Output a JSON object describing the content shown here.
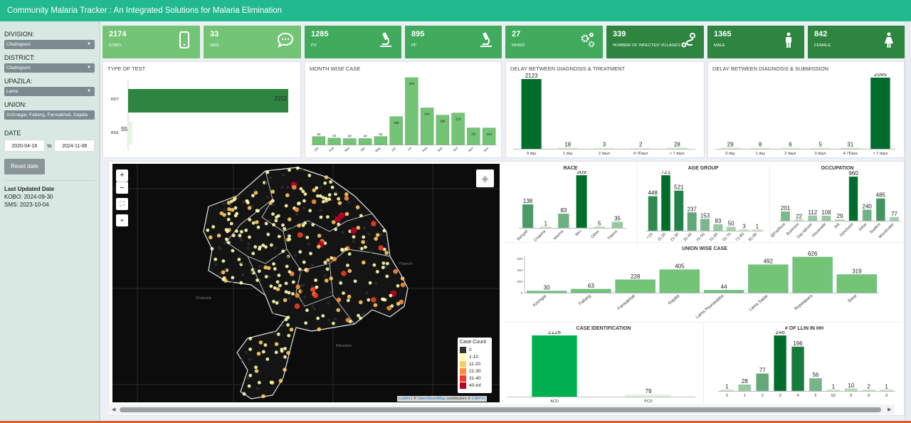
{
  "app_title": "Community Malaria Tracker : An Integrated Solutions for Malaria Elimination",
  "sidebar": {
    "division_label": "DIVISION:",
    "division_value": "Chattogram",
    "district_label": "DISTRICT:",
    "district_value": "Chattogram",
    "upazila_label": "UPAZILA:",
    "upazila_value": "Lama",
    "union_label": "UNION:",
    "union_value": "Aziznagar, Faitang, Fansiakhali, Gajalia",
    "date_label": "DATE",
    "date_from": "2020-04-18",
    "date_to_label": "to",
    "date_to": "2024-11-06",
    "reset_label": "Reset date",
    "last_updated_title": "Last Updated Date",
    "kobo_updated": "KOBO: 2024-09-30",
    "sms_updated": "SMS: 2023-10-04"
  },
  "kpis": [
    {
      "value": "2174",
      "label": "KOBO",
      "color": "#74c476",
      "icon": "mobile-phone-icon"
    },
    {
      "value": "33",
      "label": "SMS",
      "color": "#74c476",
      "icon": "chat-bubble-icon"
    },
    {
      "value": "1285",
      "label": "PV",
      "color": "#41ab5d",
      "icon": "microscope-icon"
    },
    {
      "value": "895",
      "label": "PF",
      "color": "#41ab5d",
      "icon": "microscope-icon"
    },
    {
      "value": "27",
      "label": "MIXED",
      "color": "#41ab5d",
      "icon": "gears-icon"
    },
    {
      "value": "339",
      "label": "NUMBER OF INFECTED VILLAGES",
      "color": "#2e8540",
      "icon": "route-icon"
    },
    {
      "value": "1365",
      "label": "MALE",
      "color": "#2e8540",
      "icon": "male-icon"
    },
    {
      "value": "842",
      "label": "FEMALE",
      "color": "#2e8540",
      "icon": "female-icon"
    }
  ],
  "panels": {
    "type_of_test": "TYPE OF TEST",
    "month_wise": "MONTH WISE CASE",
    "delay_treatment": "DELAY BETWEEN DIAGNOSIS & TREATMENT",
    "delay_submission": "DELAY BETWEEN DIAGNOSIS & SUBMISSION",
    "race": "RACE",
    "age_group": "AGE GROUP",
    "occupation": "OCCUPATION",
    "union_wise": "UNION WISE CASE",
    "case_identification": "CASE IDENTIFICATION",
    "llin": "# OF LLIN IN HH"
  },
  "map": {
    "zoom_in": "+",
    "zoom_out": "−",
    "place_1": "Thanchi",
    "place_2": "Chakaria",
    "place_3": "Alikadam",
    "legend_title": "Case Count",
    "legend": [
      {
        "label": "0",
        "color": "#333333"
      },
      {
        "label": "1-10",
        "color": "#ffffb2"
      },
      {
        "label": "11-20",
        "color": "#fecc5c"
      },
      {
        "label": "21-30",
        "color": "#fd8d3c"
      },
      {
        "label": "31-40",
        "color": "#f03b20"
      },
      {
        "label": "40-Inf",
        "color": "#bd0026"
      }
    ],
    "attribution_leaflet": "Leaflet",
    "attribution_sep": " | © ",
    "attribution_osm": "OpenStreetMap",
    "attribution_mid": " contributors © ",
    "attribution_carto": "CARTO"
  },
  "chart_data": [
    {
      "id": "type_of_test",
      "type": "bar",
      "orientation": "horizontal",
      "categories": [
        "RDT",
        "BSE"
      ],
      "values": [
        2152,
        55
      ]
    },
    {
      "id": "month_wise",
      "type": "bar",
      "categories": [
        "Jan",
        "Feb",
        "Mar",
        "Apr",
        "May",
        "Jun",
        "Jul",
        "Aug",
        "Sep",
        "Oct",
        "Nov",
        "Dec"
      ],
      "values": [
        53,
        43,
        40,
        40,
        53,
        186,
        446,
        244,
        196,
        210,
        111,
        110
      ]
    },
    {
      "id": "delay_treatment",
      "type": "bar",
      "categories": [
        "0 day",
        "1 day",
        "2 days",
        "4-7Days",
        "> 7 days"
      ],
      "values": [
        2123,
        18,
        3,
        2,
        28
      ]
    },
    {
      "id": "delay_submission",
      "type": "bar",
      "categories": [
        "0 day",
        "1 day",
        "2 days",
        "3 days",
        "4-7Days",
        "> 7 days"
      ],
      "values": [
        29,
        8,
        6,
        5,
        31,
        2095
      ]
    },
    {
      "id": "race",
      "type": "bar",
      "categories": [
        "Bengali",
        "Chakma",
        "Marma",
        "Mro",
        "Other",
        "Tripura"
      ],
      "values": [
        138,
        1,
        83,
        309,
        5,
        35
      ]
    },
    {
      "id": "age_group",
      "type": "bar",
      "categories": [
        "<10",
        "11-20",
        "21-30",
        "31-40",
        "41-50",
        "51-60",
        "61-70",
        "71-80",
        "81-90"
      ],
      "values": [
        448,
        721,
        521,
        237,
        153,
        83,
        50,
        3,
        1
      ]
    },
    {
      "id": "occupation",
      "type": "bar",
      "categories": [
        "@Fisilfture",
        "Business",
        "Day laborer",
        "Housewife",
        "Job",
        "Jumchash",
        "Other",
        "Student",
        "Woodcutter"
      ],
      "values": [
        201,
        22,
        112,
        108,
        29,
        960,
        240,
        485,
        77
      ]
    },
    {
      "id": "union_wise",
      "type": "bar",
      "categories": [
        "Azizngar",
        "Faitang",
        "Fansiakhali",
        "Gajalia",
        "Lama Pourasabha",
        "Lama Sadar",
        "Rupasipara",
        "Sarai"
      ],
      "values": [
        30,
        63,
        228,
        405,
        44,
        492,
        626,
        319
      ],
      "yticks": [
        0,
        200,
        400,
        600
      ]
    },
    {
      "id": "case_identification",
      "type": "bar",
      "categories": [
        "ACD",
        "PCD"
      ],
      "values": [
        2128,
        79
      ]
    },
    {
      "id": "llin",
      "type": "bar",
      "categories": [
        "0",
        "1",
        "2",
        "3",
        "4",
        "5",
        "52",
        "6",
        "8",
        "9"
      ],
      "values": [
        1,
        28,
        77,
        246,
        196,
        56,
        1,
        10,
        2,
        1
      ]
    }
  ]
}
